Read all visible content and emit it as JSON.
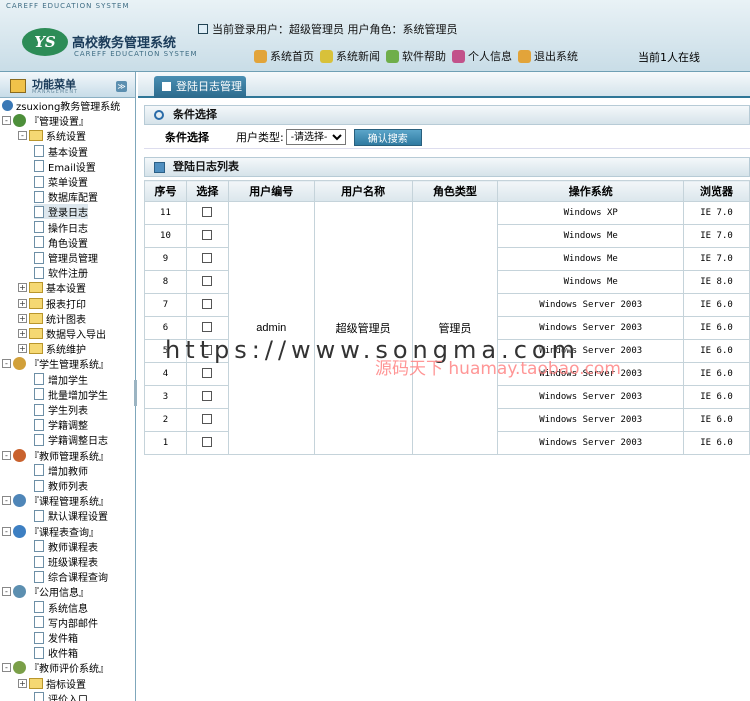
{
  "header": {
    "system_en": "CAREFF EDUCATION SYSTEM",
    "logo_mark": "YS",
    "title": "高校教务管理系统",
    "subtitle_en": "CAREFF EDUCATION SYSTEM",
    "login_info": "当前登录用户：超级管理员  用户角色：系统管理员",
    "nav": [
      {
        "label": "系统首页",
        "icon": "home-icon",
        "color": "#e2a43a"
      },
      {
        "label": "系统新闻",
        "icon": "news-icon",
        "color": "#d8c13a"
      },
      {
        "label": "软件帮助",
        "icon": "help-icon",
        "color": "#6fae4a"
      },
      {
        "label": "个人信息",
        "icon": "user-icon",
        "color": "#c2528a"
      },
      {
        "label": "退出系统",
        "icon": "exit-icon",
        "color": "#e2a43a"
      }
    ],
    "online": "当前1人在线"
  },
  "sidebar": {
    "title": "功能菜单",
    "subtitle": "MANAGEMENT",
    "tree": [
      {
        "label": "zsuxiong教务管理系统",
        "kind": "root",
        "level": 0
      },
      {
        "label": "『管理设置』",
        "kind": "group",
        "level": 0,
        "toggle": "-",
        "color": "#4d8f3a"
      },
      {
        "label": "系统设置",
        "kind": "folder",
        "level": 1,
        "toggle": "-"
      },
      {
        "label": "基本设置",
        "kind": "doc",
        "level": 2
      },
      {
        "label": "Email设置",
        "kind": "doc",
        "level": 2
      },
      {
        "label": "菜单设置",
        "kind": "doc",
        "level": 2
      },
      {
        "label": "数据库配置",
        "kind": "doc",
        "level": 2
      },
      {
        "label": "登录日志",
        "kind": "doc",
        "level": 2,
        "selected": true
      },
      {
        "label": "操作日志",
        "kind": "doc",
        "level": 2
      },
      {
        "label": "角色设置",
        "kind": "doc",
        "level": 2
      },
      {
        "label": "管理员管理",
        "kind": "doc",
        "level": 2
      },
      {
        "label": "软件注册",
        "kind": "doc",
        "level": 2
      },
      {
        "label": "基本设置",
        "kind": "folder",
        "level": 1,
        "toggle": "+"
      },
      {
        "label": "报表打印",
        "kind": "folder",
        "level": 1,
        "toggle": "+"
      },
      {
        "label": "统计图表",
        "kind": "folder",
        "level": 1,
        "toggle": "+"
      },
      {
        "label": "数据导入导出",
        "kind": "folder",
        "level": 1,
        "toggle": "+"
      },
      {
        "label": "系统维护",
        "kind": "folder",
        "level": 1,
        "toggle": "+"
      },
      {
        "label": "『学生管理系统』",
        "kind": "group",
        "level": 0,
        "toggle": "-",
        "color": "#d1a03a"
      },
      {
        "label": "增加学生",
        "kind": "doc",
        "level": 1
      },
      {
        "label": "批量增加学生",
        "kind": "doc",
        "level": 1
      },
      {
        "label": "学生列表",
        "kind": "doc",
        "level": 1
      },
      {
        "label": "学籍调整",
        "kind": "doc",
        "level": 1
      },
      {
        "label": "学籍调整日志",
        "kind": "doc",
        "level": 1
      },
      {
        "label": "『教师管理系统』",
        "kind": "group",
        "level": 0,
        "toggle": "-",
        "color": "#c9622e"
      },
      {
        "label": "增加教师",
        "kind": "doc",
        "level": 1
      },
      {
        "label": "教师列表",
        "kind": "doc",
        "level": 1
      },
      {
        "label": "『课程管理系统』",
        "kind": "group",
        "level": 0,
        "toggle": "-",
        "color": "#4f86b8"
      },
      {
        "label": "默认课程设置",
        "kind": "doc",
        "level": 1
      },
      {
        "label": "『课程表查询』",
        "kind": "group",
        "level": 0,
        "toggle": "-",
        "color": "#3d7fc2"
      },
      {
        "label": "教师课程表",
        "kind": "doc",
        "level": 1
      },
      {
        "label": "班级课程表",
        "kind": "doc",
        "level": 1
      },
      {
        "label": "综合课程查询",
        "kind": "doc",
        "level": 1
      },
      {
        "label": "『公用信息』",
        "kind": "group",
        "level": 0,
        "toggle": "-",
        "color": "#5c8fb0"
      },
      {
        "label": "系统信息",
        "kind": "doc",
        "level": 1
      },
      {
        "label": "写内部邮件",
        "kind": "doc",
        "level": 1
      },
      {
        "label": "发件箱",
        "kind": "doc",
        "level": 1
      },
      {
        "label": "收件箱",
        "kind": "doc",
        "level": 1
      },
      {
        "label": "『教师评价系统』",
        "kind": "group",
        "level": 0,
        "toggle": "-",
        "color": "#7a9f48"
      },
      {
        "label": "指标设置",
        "kind": "folder",
        "level": 1,
        "toggle": "+"
      },
      {
        "label": "评价入口",
        "kind": "doc",
        "level": 1
      }
    ]
  },
  "main": {
    "tab": "登陆日志管理",
    "condition_section": "条件选择",
    "condition_label": "条件选择",
    "user_type_label": "用户类型:",
    "user_type_value": "-请选择-",
    "search_button": "确认搜索",
    "list_section": "登陆日志列表",
    "columns": [
      "序号",
      "选择",
      "用户编号",
      "用户名称",
      "角色类型",
      "操作系统",
      "浏览器"
    ],
    "shared": {
      "user_id": "admin",
      "user_name": "超级管理员",
      "role": "管理员"
    },
    "rows": [
      {
        "no": "11",
        "os": "Windows XP",
        "browser": "IE 7.0"
      },
      {
        "no": "10",
        "os": "Windows Me",
        "browser": "IE 7.0"
      },
      {
        "no": "9",
        "os": "Windows Me",
        "browser": "IE 7.0"
      },
      {
        "no": "8",
        "os": "Windows Me",
        "browser": "IE 8.0"
      },
      {
        "no": "7",
        "os": "Windows Server 2003",
        "browser": "IE 6.0"
      },
      {
        "no": "6",
        "os": "Windows Server 2003",
        "browser": "IE 6.0"
      },
      {
        "no": "5",
        "os": "Windows Server 2003",
        "browser": "IE 6.0"
      },
      {
        "no": "4",
        "os": "Windows Server 2003",
        "browser": "IE 6.0"
      },
      {
        "no": "3",
        "os": "Windows Server 2003",
        "browser": "IE 6.0"
      },
      {
        "no": "2",
        "os": "Windows Server 2003",
        "browser": "IE 6.0"
      },
      {
        "no": "1",
        "os": "Windows Server 2003",
        "browser": "IE 6.0"
      }
    ]
  },
  "watermark": {
    "url": "https://www.songma.com",
    "shop": "源码天下 huamay.taobao.com"
  }
}
